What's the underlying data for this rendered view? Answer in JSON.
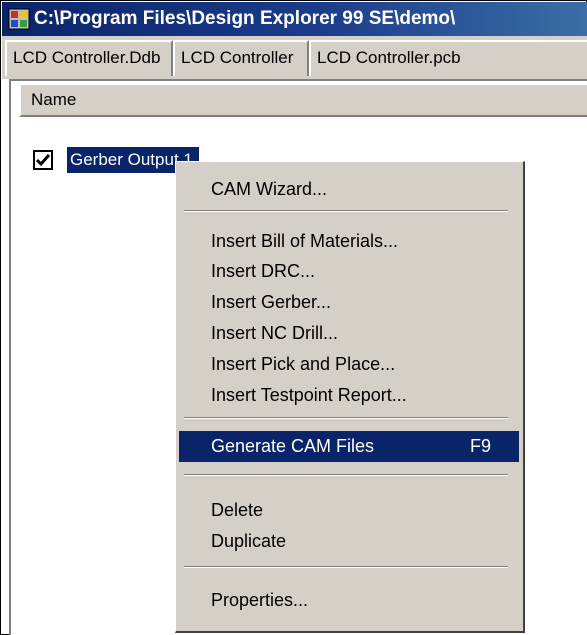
{
  "window": {
    "title": "C:\\Program Files\\Design Explorer 99 SE\\demo\\"
  },
  "tabs": [
    {
      "label": "LCD Controller.Ddb"
    },
    {
      "label": "LCD Controller"
    },
    {
      "label": "LCD Controller.pcb"
    }
  ],
  "list": {
    "column_header": "Name",
    "items": [
      {
        "label": "Gerber Output 1",
        "checked": true
      }
    ]
  },
  "context_menu": {
    "groups": [
      [
        {
          "label": "CAM Wizard..."
        }
      ],
      [
        {
          "label": "Insert Bill of Materials..."
        },
        {
          "label": "Insert DRC..."
        },
        {
          "label": "Insert Gerber..."
        },
        {
          "label": "Insert NC Drill..."
        },
        {
          "label": "Insert Pick and Place..."
        },
        {
          "label": "Insert Testpoint Report..."
        }
      ],
      [
        {
          "label": "Generate CAM Files",
          "shortcut": "F9",
          "highlighted": true
        }
      ],
      [
        {
          "label": "Delete"
        },
        {
          "label": "Duplicate"
        }
      ],
      [
        {
          "label": "Properties..."
        }
      ]
    ]
  },
  "icons": {
    "app": "design-explorer-app-icon",
    "check": "checkmark-icon"
  },
  "colors": {
    "title_bar": "#0a246a",
    "selection": "#0a246a",
    "menu_bg": "#d4d0c8",
    "window_bg": "#d4d0c8"
  }
}
